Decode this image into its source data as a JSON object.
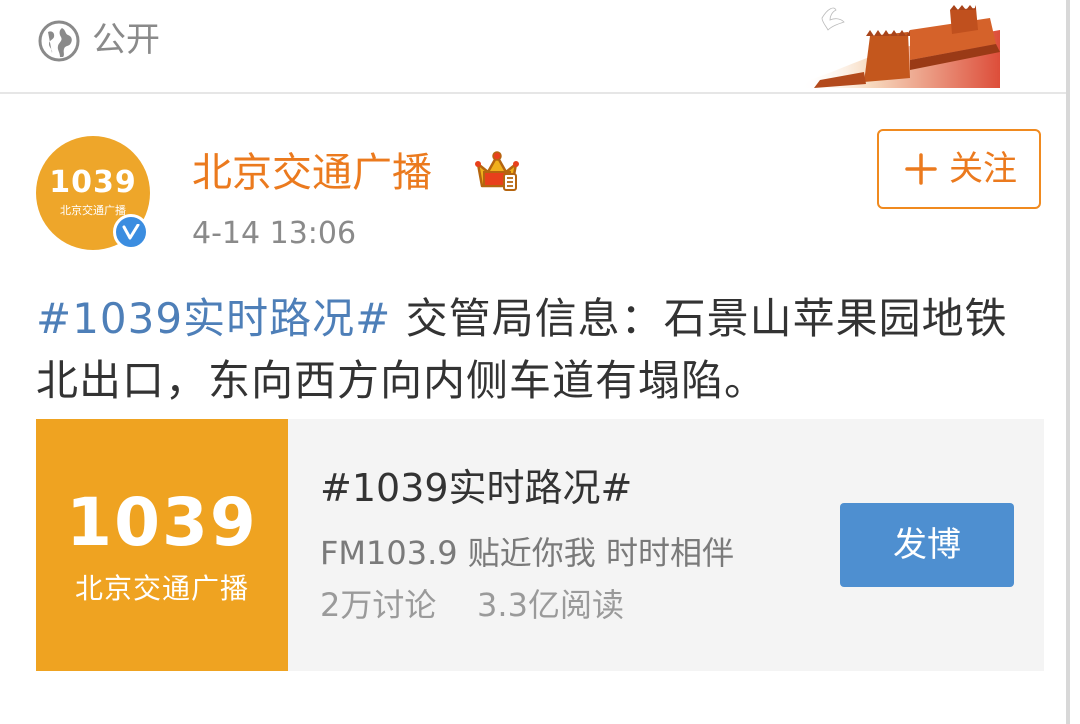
{
  "topbar": {
    "visibility_icon": "globe-icon",
    "visibility_label": "公开",
    "decoration": "great-wall-dove-illustration"
  },
  "post": {
    "author": {
      "name": "北京交通广播",
      "avatar_text": "1039",
      "avatar_subtext": "北京交通广播",
      "verified": true,
      "badge_icon": "crown-membership-icon"
    },
    "time": "4-14 13:06",
    "follow_button": {
      "icon": "plus-icon",
      "label": "关注"
    },
    "hashtag": "#1039实时路况#",
    "body": " 交管局信息：石景山苹果园地铁北出口，东向西方向内侧车道有塌陷。"
  },
  "topic_card": {
    "thumb_text": "1039",
    "thumb_subtext": "北京交通广播",
    "title": "#1039实时路况#",
    "description": "FM103.9 贴近你我 时时相伴",
    "stats": "2万讨论    3.3亿阅读",
    "action_label": "发博"
  },
  "colors": {
    "accent_orange": "#eb7a1e",
    "link_blue": "#4e7fb8",
    "button_blue": "#4e8fd0",
    "logo_yellow": "#efa321"
  }
}
